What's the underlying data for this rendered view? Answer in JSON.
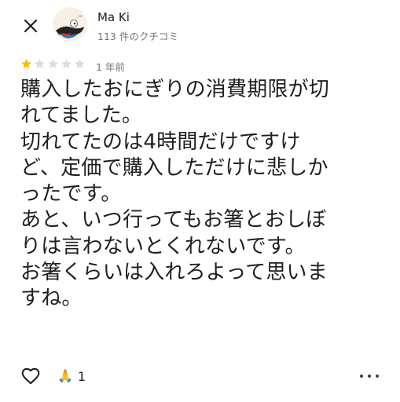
{
  "header": {
    "close_icon": "close-icon",
    "author_name": "Ma Ki",
    "author_meta": "113 件のクチコミ"
  },
  "rating": {
    "stars": 1,
    "max_stars": 5,
    "filled_color": "#fbbc04",
    "empty_color": "#dadce0",
    "time_ago": "1 年前"
  },
  "review": {
    "lines": [
      "購入したおにぎりの消費期限が切",
      "れてました。",
      "切れてたのは4時間だけですけ",
      "ど、定価で購入しただけに悲しか",
      "ったです。",
      "あと、いつ行ってもお箸とおしぼ",
      "りは言わないとくれないです。",
      "お箸くらいは入れろよって思いま",
      "すね。"
    ]
  },
  "actions": {
    "like_icon": "heart-outline-icon",
    "reaction_emoji": "🙏",
    "reaction_count": "1",
    "more_icon": "more-horizontal-icon"
  }
}
